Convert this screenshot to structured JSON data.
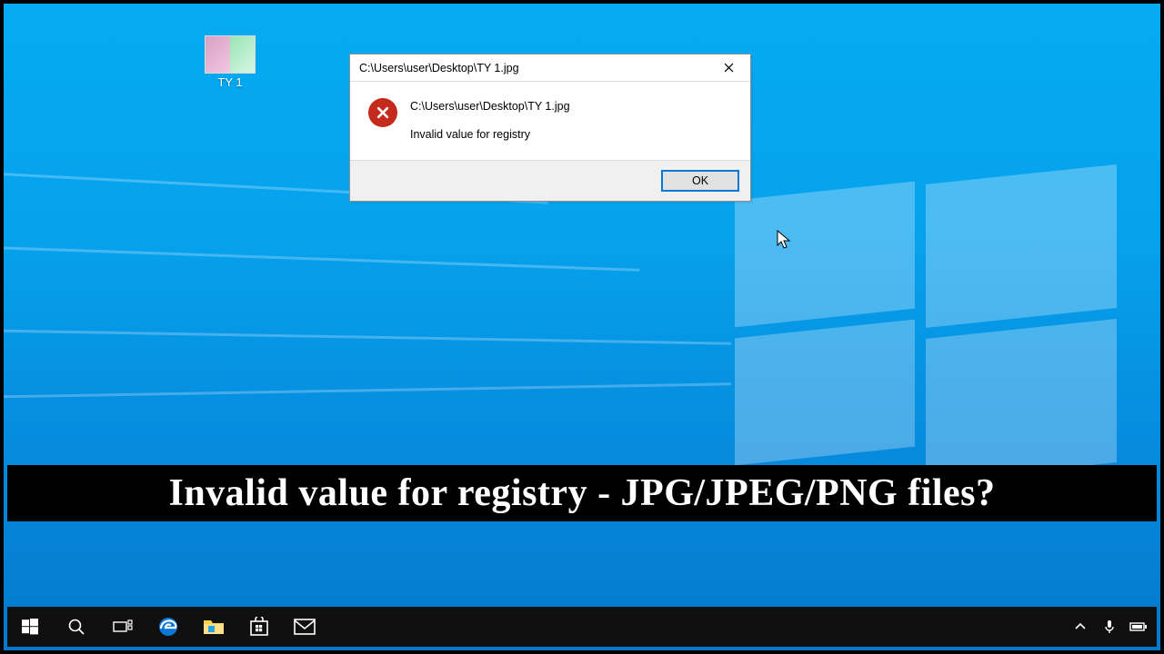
{
  "desktop": {
    "icon": {
      "label": "TY 1"
    }
  },
  "dialog": {
    "title": "C:\\Users\\user\\Desktop\\TY 1.jpg",
    "heading": "C:\\Users\\user\\Desktop\\TY 1.jpg",
    "message": "Invalid value for registry",
    "ok_label": "OK"
  },
  "caption": "Invalid value for registry - JPG/JPEG/PNG files?",
  "taskbar": {
    "items": [
      "start",
      "search",
      "task-view",
      "edge",
      "file-explorer",
      "store",
      "mail"
    ],
    "tray": [
      "chevron-up",
      "microphone",
      "battery"
    ]
  }
}
